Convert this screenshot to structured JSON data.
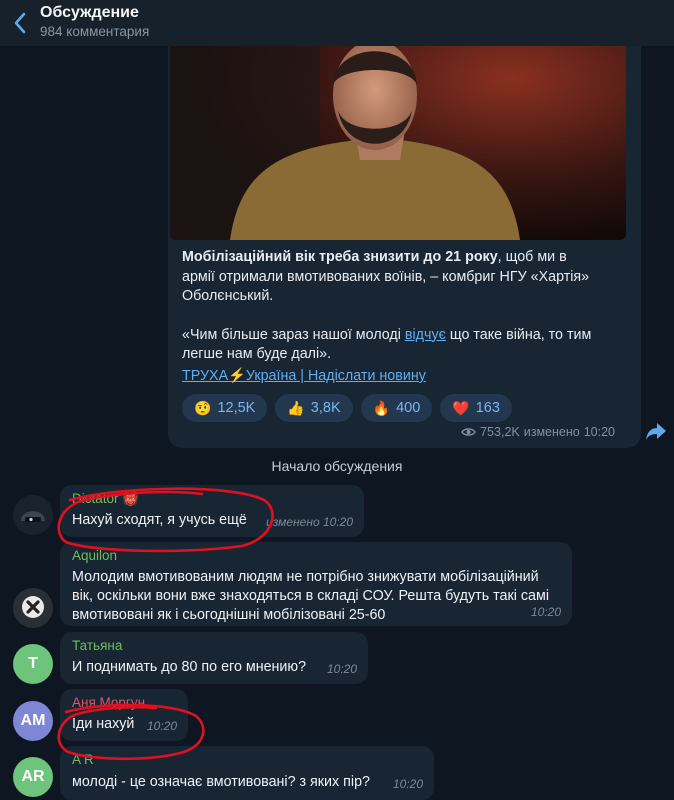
{
  "header": {
    "title": "Обсуждение",
    "subtitle": "984 комментария"
  },
  "post": {
    "headline_bold": "Мобілізаційний вік треба знизити до 21 року",
    "headline_rest": ", щоб ми в армії отримали вмотивованих воїнів, – комбриг НГУ «Хартія» Оболєнський.",
    "quote_before": "«Чим більше зараз нашої молоді ",
    "quote_link": "відчує",
    "quote_after": " що таке війна, то тим легше нам буде далі».",
    "signature": "ТРУХА⚡Україна | Надіслати новину",
    "reactions": [
      {
        "emoji": "🤨",
        "count": "12,5K"
      },
      {
        "emoji": "👍",
        "count": "3,8K"
      },
      {
        "emoji": "🔥",
        "count": "400"
      },
      {
        "emoji": "❤️",
        "count": "163"
      }
    ],
    "views": "753,2K",
    "edited": "изменено",
    "time": "10:20"
  },
  "discussion_start": "Начало обсуждения",
  "comments": [
    {
      "name": "Dictator 👹",
      "name_color": "#6fbe5b",
      "text": "Нахуй сходят, я учусь ещё",
      "meta": "изменено 10:20"
    },
    {
      "name": "Aquilon",
      "name_color": "#6fbe5b",
      "text": "Молодим вмотивованим людям не потрібно знижувати мобілізаційний вік, оскільки вони вже знаходяться в складі СОУ. Решта будуть такі самі вмотивовані як і сьогоднішні мобілізовані 25-60",
      "meta": "10:20"
    },
    {
      "name": "Татьяна",
      "name_color": "#6fbe5b",
      "initials": "T",
      "avatar_color": "#6dc47a",
      "text": "И поднимать до 80 по его мнению?",
      "meta": "10:20"
    },
    {
      "name": "Аня Моргун",
      "name_color": "#e0556b",
      "initials": "AM",
      "avatar_color": "#7f86d6",
      "text": "Іди нахуй",
      "meta": "10:20"
    },
    {
      "name": "A R",
      "name_color": "#6fbe5b",
      "initials": "AR",
      "avatar_color": "#6dc47a",
      "text": "молоді - це означає вмотивовані? з яких пір?",
      "meta": "10:20"
    }
  ]
}
